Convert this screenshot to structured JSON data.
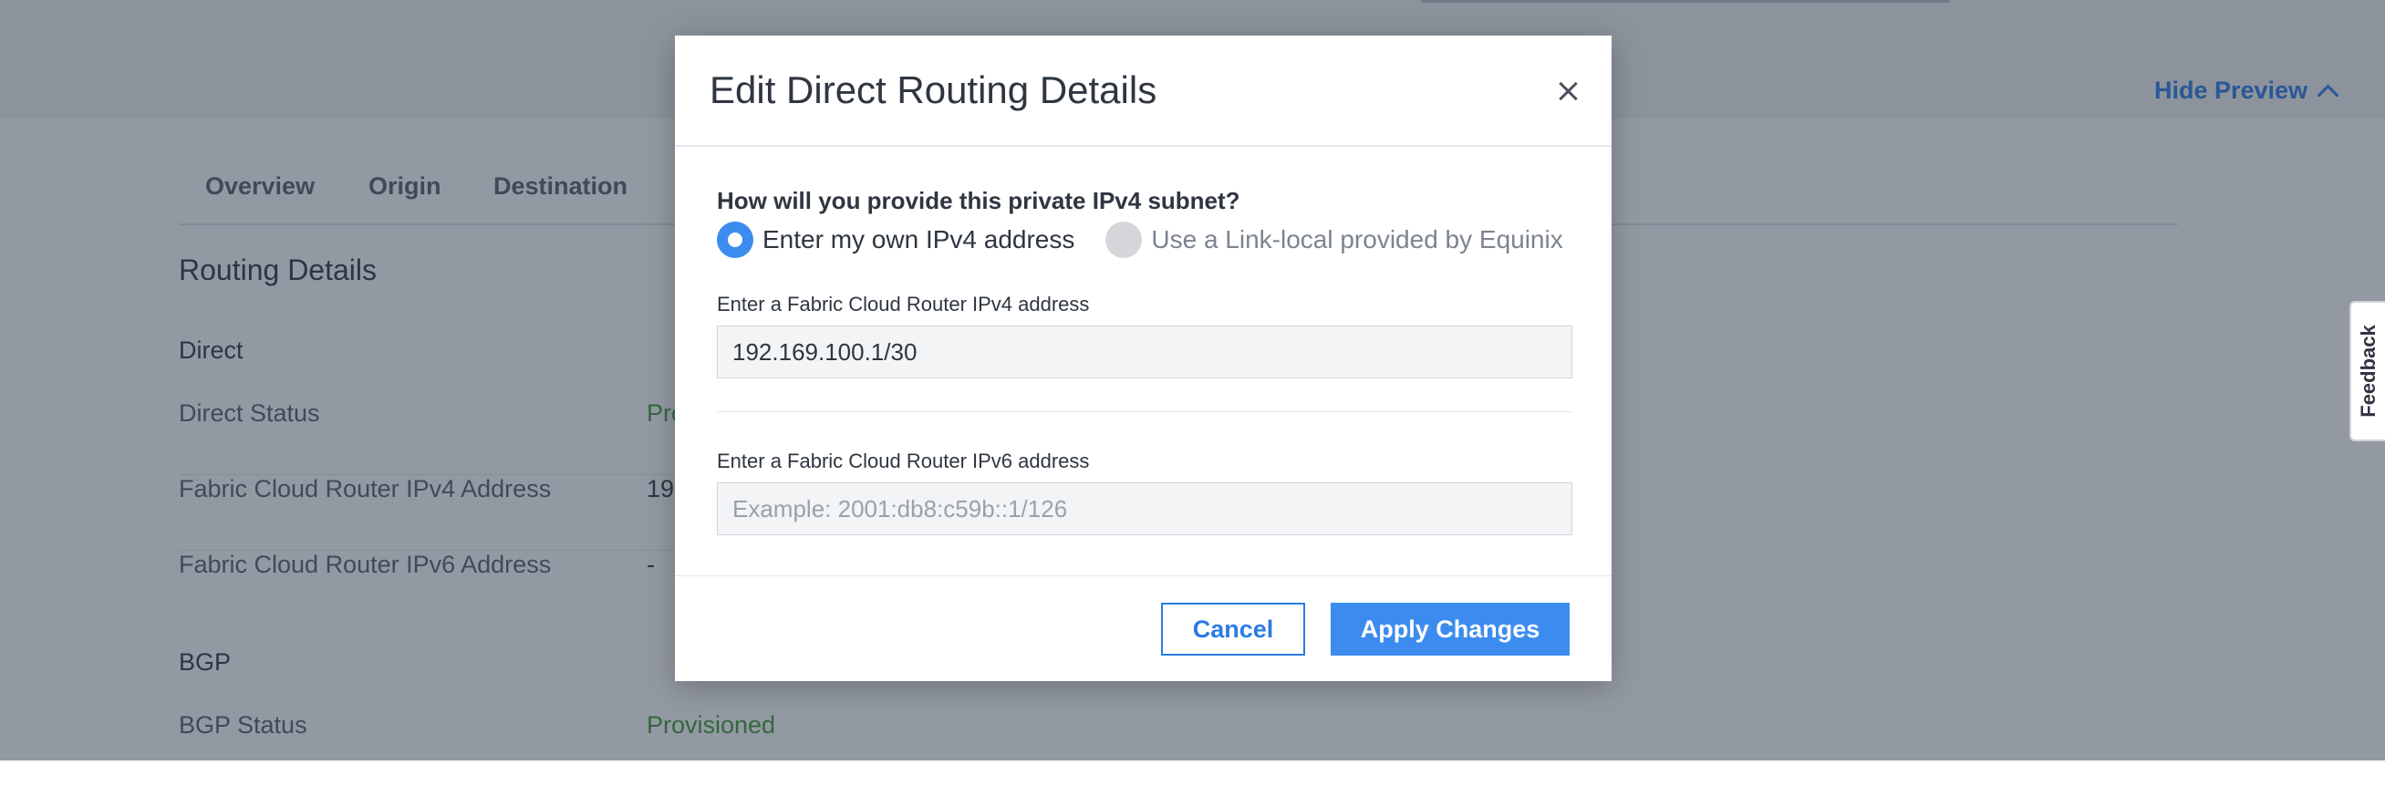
{
  "header": {
    "hide_preview": "Hide Preview"
  },
  "tabs": [
    "Overview",
    "Origin",
    "Destination"
  ],
  "routing_details": {
    "title": "Routing Details",
    "direct": {
      "title": "Direct",
      "rows": [
        {
          "label": "Direct Status",
          "value": "Pro"
        },
        {
          "label": "Fabric Cloud Router IPv4 Address",
          "value": "19"
        },
        {
          "label": "Fabric Cloud Router IPv6 Address",
          "value": "-"
        }
      ]
    },
    "bgp": {
      "title": "BGP",
      "rows": [
        {
          "label": "BGP Status",
          "value": "Provisioned"
        }
      ]
    }
  },
  "modal": {
    "title": "Edit Direct Routing Details",
    "question": "How will you provide this private IPv4 subnet?",
    "options": [
      {
        "label": "Enter my own IPv4 address",
        "selected": true
      },
      {
        "label": "Use a Link-local provided by Equinix",
        "selected": false
      }
    ],
    "ipv4": {
      "label": "Enter a Fabric Cloud Router IPv4 address",
      "value": "192.169.100.1/30"
    },
    "ipv6": {
      "label": "Enter a Fabric Cloud Router IPv6 address",
      "value": "",
      "placeholder": "Example: 2001:db8:c59b::1/126"
    },
    "cancel_label": "Cancel",
    "apply_label": "Apply Changes"
  },
  "feedback_label": "Feedback",
  "colors": {
    "accent": "#2c7be5",
    "primary_button": "#3c8cf0",
    "status_green": "#3f9c35",
    "overlay": "rgba(40,52,70,0.5)"
  },
  "icons": {
    "close": "close-icon",
    "hide_preview": "chevron-up-icon"
  }
}
